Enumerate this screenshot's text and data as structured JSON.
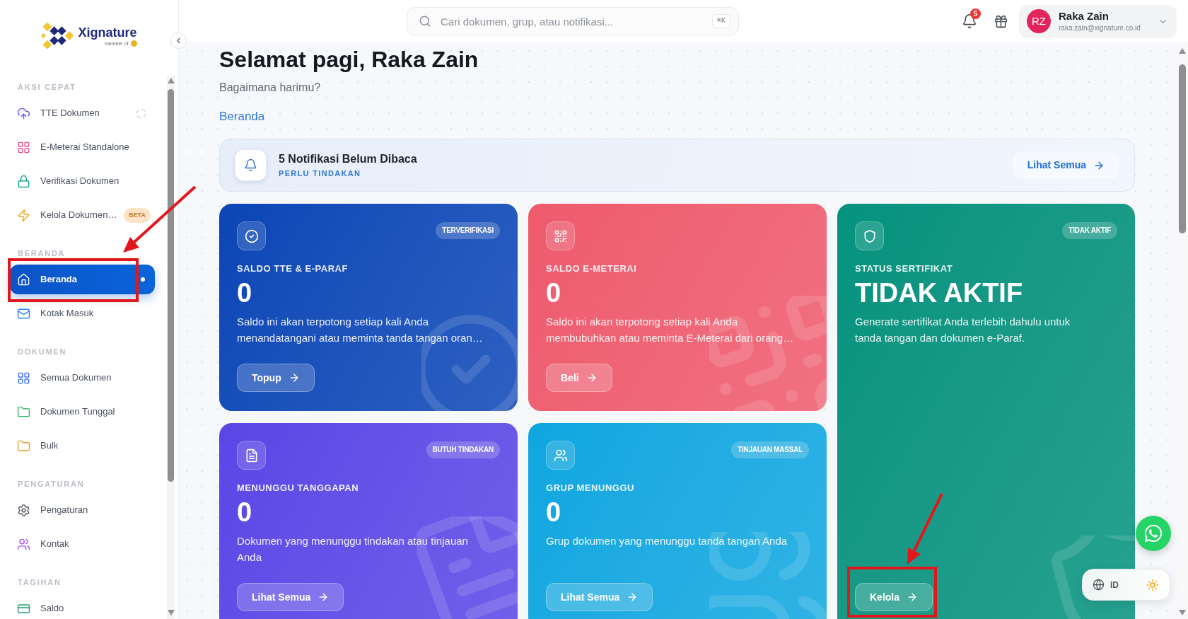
{
  "sidebar": {
    "logo": {
      "name": "Xignature",
      "tagline": "member of"
    },
    "sections": [
      {
        "title": "AKSI CEPAT",
        "items": [
          {
            "label": "TTE Dokumen",
            "selected": false,
            "loading": true
          },
          {
            "label": "E-Meterai Standalone",
            "selected": false,
            "loading": false
          },
          {
            "label": "Verifikasi Dokumen",
            "selected": false,
            "loading": false
          },
          {
            "label": "Kelola Dokumen…",
            "selected": false,
            "loading": false,
            "badge": "BETA"
          }
        ]
      },
      {
        "title": "BERANDA",
        "items": [
          {
            "label": "Beranda",
            "selected": true,
            "loading": false
          },
          {
            "label": "Kotak Masuk",
            "selected": false,
            "loading": false
          }
        ]
      },
      {
        "title": "DOKUMEN",
        "items": [
          {
            "label": "Semua Dokumen",
            "selected": false,
            "loading": false
          },
          {
            "label": "Dokumen Tunggal",
            "selected": false,
            "loading": false
          },
          {
            "label": "Bulk",
            "selected": false,
            "loading": false
          }
        ]
      },
      {
        "title": "PENGATURAN",
        "items": [
          {
            "label": "Pengaturan",
            "selected": false,
            "loading": false
          },
          {
            "label": "Kontak",
            "selected": false,
            "loading": false
          }
        ]
      },
      {
        "title": "TAGIHAN",
        "items": [
          {
            "label": "Saldo",
            "selected": false,
            "loading": false
          }
        ]
      }
    ]
  },
  "header": {
    "search": {
      "placeholder": "Cari dokumen, grup, atau notifikasi...",
      "shortcut": "⌘K"
    },
    "notification_count": "5",
    "user": {
      "initials": "RZ",
      "name": "Raka Zain",
      "email": "raka.zain@xignature.co.id"
    }
  },
  "page": {
    "title": "Selamat pagi, Raka Zain",
    "subtitle": "Bagaimana harimu?",
    "breadcrumb": "Beranda"
  },
  "notice": {
    "title": "5 Notifikasi Belum Dibaca",
    "subtitle": "PERLU TINDAKAN",
    "action": "Lihat Semua"
  },
  "cards": [
    {
      "label": "SALDO TTE & E-PARAF",
      "badge": "TERVERIFIKASI",
      "value": "0",
      "description": "Saldo ini akan terpotong setiap kali Anda menandatangani atau meminta tanda tangan oran…",
      "button": "Topup",
      "color": "#0b46b6"
    },
    {
      "label": "SALDO E-METERAI",
      "value": "0",
      "description": "Saldo ini akan terpotong setiap kali Anda membubuhkan atau meminta E-Meterai dari orang…",
      "button": "Beli",
      "color": "#ee5a6d"
    },
    {
      "label": "MENUNGGU TANGGAPAN",
      "badge": "BUTUH TINDAKAN",
      "value": "0",
      "description": "Dokumen yang menunggu tindakan atau tinjauan Anda",
      "button": "Lihat Semua",
      "color": "#5a46e6"
    },
    {
      "label": "GRUP MENUNGGU",
      "badge": "TINJAUAN MASSAL",
      "value": "0",
      "description": "Grup dokumen yang menunggu tanda tangan Anda",
      "button": "Lihat Semua",
      "color": "#0ea6e0"
    }
  ],
  "status_card": {
    "label": "STATUS SERTIFIKAT",
    "badge": "TIDAK AKTIF",
    "value": "TIDAK AKTIF",
    "description": "Generate sertifikat Anda terlebih dahulu untuk tanda tangan dan dokumen e-Paraf.",
    "button": "Kelola",
    "color": "#03927e"
  },
  "language": {
    "code": "ID"
  }
}
